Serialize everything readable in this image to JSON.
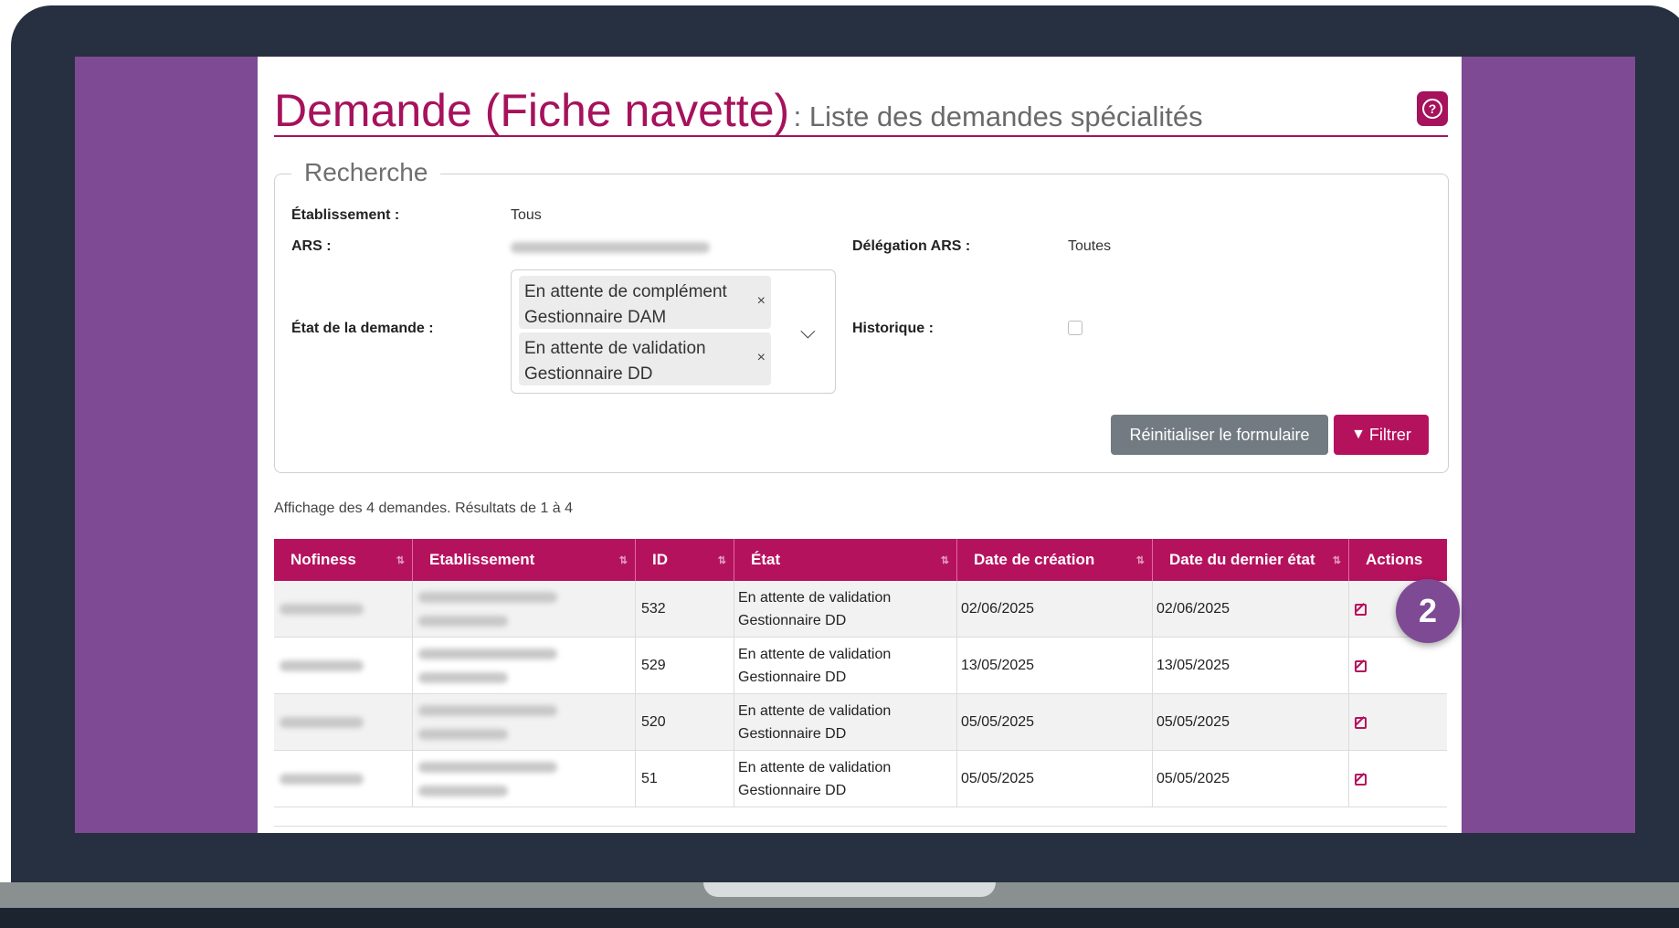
{
  "header": {
    "title": "Demande (Fiche navette)",
    "subtitle": ": Liste des demandes spécialités",
    "help_icon": "question-circle-icon"
  },
  "search": {
    "legend": "Recherche",
    "etablissement_label": "Établissement :",
    "etablissement_value": "Tous",
    "ars_label": "ARS :",
    "delegation_label": "Délégation ARS :",
    "delegation_value": "Toutes",
    "etat_label": "État de la demande :",
    "etat_chips": [
      {
        "line1": "En attente de complément",
        "line2": "Gestionnaire DAM"
      },
      {
        "line1": "En attente de validation",
        "line2": "Gestionnaire DD"
      }
    ],
    "chip_remove": "×",
    "historique_label": "Historique :",
    "historique_checked": false,
    "reset_label": "Réinitialiser le formulaire",
    "filter_label": "Filtrer",
    "filter_icon": "funnel-icon"
  },
  "results": {
    "summary": "Affichage des 4 demandes. Résultats de 1 à 4"
  },
  "table": {
    "columns": [
      "Nofiness",
      "Etablissement",
      "ID",
      "État",
      "Date de création",
      "Date du dernier état",
      "Actions"
    ],
    "rows": [
      {
        "id": "532",
        "etat1": "En attente de validation",
        "etat2": "Gestionnaire DD",
        "created": "02/06/2025",
        "last": "02/06/2025"
      },
      {
        "id": "529",
        "etat1": "En attente de validation",
        "etat2": "Gestionnaire DD",
        "created": "13/05/2025",
        "last": "13/05/2025"
      },
      {
        "id": "520",
        "etat1": "En attente de validation",
        "etat2": "Gestionnaire DD",
        "created": "05/05/2025",
        "last": "05/05/2025"
      },
      {
        "id": "51",
        "etat1": "En attente de validation",
        "etat2": "Gestionnaire DD",
        "created": "05/05/2025",
        "last": "05/05/2025"
      }
    ],
    "action_icon": "edit-icon"
  },
  "step_badge": "2",
  "colors": {
    "brand": "#b5125e",
    "frame": "#263040",
    "screen_bg": "#7e4a94",
    "reset_button": "#737b82"
  }
}
